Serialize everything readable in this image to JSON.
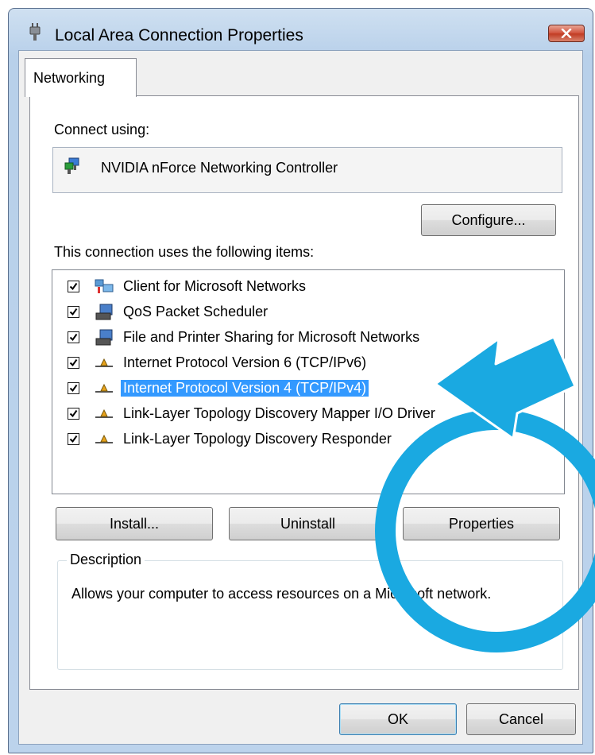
{
  "window": {
    "title": "Local Area Connection Properties",
    "close_icon": "close-x-icon",
    "app_icon": "network-plug-icon"
  },
  "tabs": [
    {
      "label": "Networking",
      "selected": true
    }
  ],
  "connect_using": {
    "label": "Connect using:",
    "adapter_name": "NVIDIA nForce Networking Controller",
    "adapter_icon": "network-adapter-icon",
    "configure_label": "Configure..."
  },
  "items": {
    "label": "This connection uses the following items:",
    "list": [
      {
        "label": "Client for Microsoft Networks",
        "checked": true,
        "icon": "network-client-icon",
        "selected": false
      },
      {
        "label": "QoS Packet Scheduler",
        "checked": true,
        "icon": "computer-service-icon",
        "selected": false
      },
      {
        "label": "File and Printer Sharing for Microsoft Networks",
        "checked": true,
        "icon": "computer-service-icon",
        "selected": false
      },
      {
        "label": "Internet Protocol Version 6 (TCP/IPv6)",
        "checked": true,
        "icon": "protocol-icon",
        "selected": false
      },
      {
        "label": "Internet Protocol Version 4 (TCP/IPv4)",
        "checked": true,
        "icon": "protocol-icon",
        "selected": true
      },
      {
        "label": "Link-Layer Topology Discovery Mapper I/O Driver",
        "checked": true,
        "icon": "protocol-icon",
        "selected": false
      },
      {
        "label": "Link-Layer Topology Discovery Responder",
        "checked": true,
        "icon": "protocol-icon",
        "selected": false
      }
    ]
  },
  "buttons": {
    "install": "Install...",
    "uninstall": "Uninstall",
    "properties": "Properties",
    "ok": "OK",
    "cancel": "Cancel"
  },
  "description": {
    "legend": "Description",
    "text": "Allows your computer to access resources on a Microsoft network."
  },
  "annotations": {
    "arrow_icon": "arrow-pointer-icon",
    "circle_icon": "highlight-circle-icon",
    "color": "#1aa9e1"
  },
  "colors": {
    "selection": "#3399ff",
    "accent_annotation": "#1aa9e1",
    "frame": "#bcd3ec"
  }
}
